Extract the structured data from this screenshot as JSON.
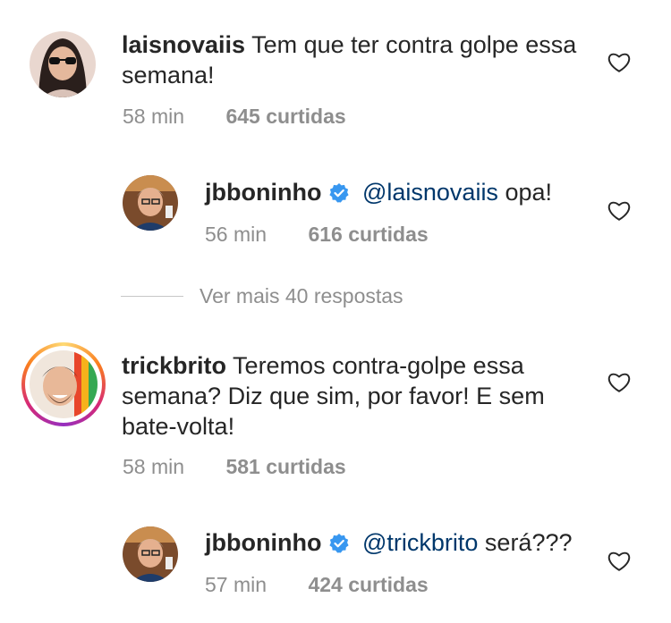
{
  "comments": [
    {
      "username": "laisnovaiis",
      "text": "Tem que ter contra golpe essa semana!",
      "time": "58 min",
      "likes": "645 curtidas"
    },
    {
      "username": "jbboninho",
      "verified": true,
      "mention": "@laisnovaiis",
      "text": "opa!",
      "time": "56 min",
      "likes": "616 curtidas"
    },
    {
      "username": "trickbrito",
      "text": "Teremos contra-golpe essa semana? Diz que sim, por favor! E sem bate-volta!",
      "time": "58 min",
      "likes": "581 curtidas"
    },
    {
      "username": "jbboninho",
      "verified": true,
      "mention": "@trickbrito",
      "text": "será???",
      "time": "57 min",
      "likes": "424 curtidas"
    }
  ],
  "view_more": "Ver mais 40 respostas",
  "colors": {
    "text": "#262626",
    "meta": "#8e8e8e",
    "mention": "#00376b",
    "verified": "#3897f0"
  }
}
